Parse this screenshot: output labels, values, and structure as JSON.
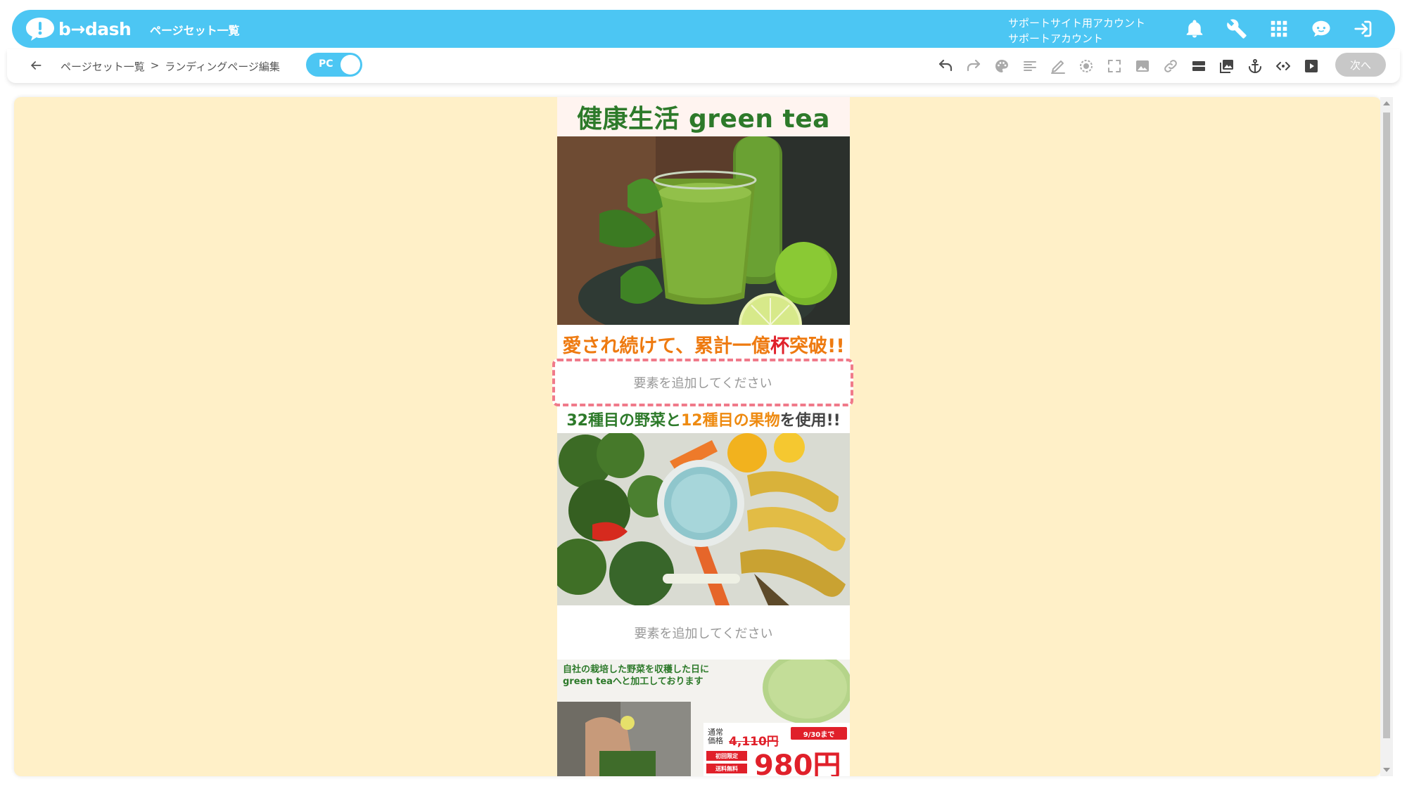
{
  "app": {
    "brand": "b→dash",
    "page_title": "ページセット一覧",
    "account_line1": "サポートサイト用アカウント",
    "account_line2": "サポートアカウント"
  },
  "header_icons": [
    "bell-icon",
    "wrench-icon",
    "apps-grid-icon",
    "support-chat-icon",
    "logout-icon"
  ],
  "breadcrumb": {
    "items": [
      "ページセット一覧",
      "ランディングページ編集"
    ],
    "separator": ">"
  },
  "device_toggle": {
    "label": "PC"
  },
  "toolbar_tools": [
    "undo-icon",
    "redo-icon",
    "palette-icon",
    "align-icon",
    "pen-icon",
    "target-icon",
    "fullscreen-icon",
    "image-icon",
    "link-icon",
    "layout-icon",
    "gallery-icon",
    "anchor-icon",
    "code-icon",
    "play-icon"
  ],
  "next_button": {
    "label": "次へ"
  },
  "landing_page": {
    "title": "健康生活 green tea",
    "headline1_a": "愛され続けて、累計一億",
    "headline1_b": "杯",
    "headline1_c": "突破!!",
    "dropzone_text": "要素を追加してください",
    "headline2_a": "32種目の野菜と",
    "headline2_b": "12種目の果物",
    "headline2_c": "を使用!!",
    "dropzone2_text": "要素を追加してください",
    "caption_line1": "自社の栽培した野菜を収穫した日に",
    "caption_line2": "green teaへと加工しております",
    "price_label": "通常\n価格",
    "price_old": "4,110円",
    "price_badge": "9/30まで",
    "tag1": "初回限定",
    "tag2": "送料無料",
    "price_new": "980円"
  },
  "colors": {
    "header_blue": "#4cc6f3",
    "canvas_bg": "#fff0c8",
    "title_green": "#2d7a2a",
    "accent_orange": "#ee7a10",
    "accent_red": "#e0202a",
    "dropzone_border": "#f07a8a"
  }
}
